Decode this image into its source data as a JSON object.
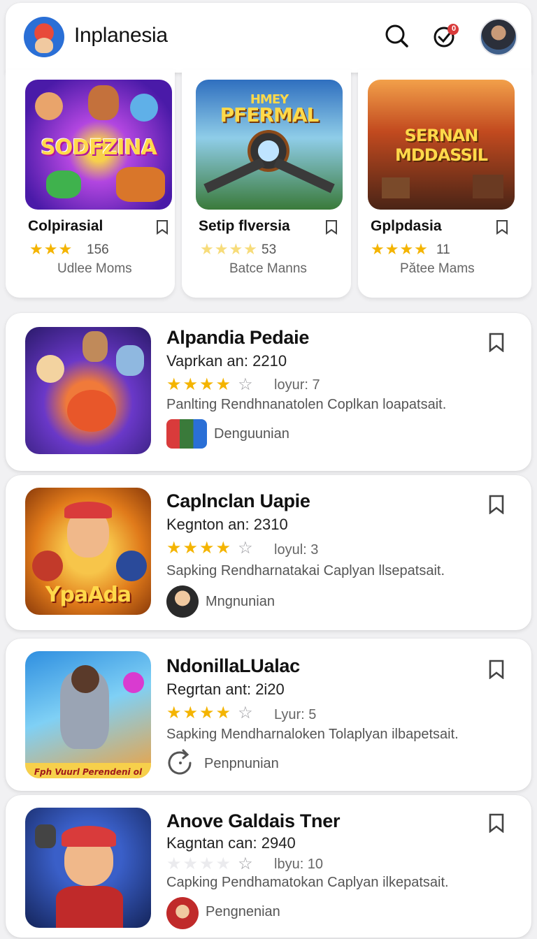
{
  "header": {
    "app_name": "Inplanesia",
    "notification_count": "0"
  },
  "top_cards": [
    {
      "art_text": "SODFZINA",
      "title": "Colpirasial",
      "stars": "★★★",
      "count": "156",
      "sub": "Udlee Moms",
      "colors": [
        "#6b2bd9",
        "#e0479e"
      ]
    },
    {
      "art_text_top": "HMEY",
      "art_text": "PFERMAL",
      "title": "Setip flversia",
      "stars": "★★★★",
      "count": "53",
      "sub": "Batce Manns",
      "colors": [
        "#1f6fb8",
        "#7fc9f0"
      ]
    },
    {
      "art_text": "SERNAN MDDASSIL",
      "title": "Gplpdasia",
      "stars": "★★★★",
      "count": "11",
      "sub": "Pătee Mams",
      "colors": [
        "#a33a1d",
        "#f08a2e"
      ]
    }
  ],
  "rows": [
    {
      "title": "Alpandia Pedaie",
      "meta": "Vaprkan an:  2210",
      "filled": "★★★★",
      "empty": "☆",
      "label": "loyur:  7",
      "desc": "Panlting Rendhnanatolen Coplkan loapatsait.",
      "dev": "Denguunian"
    },
    {
      "title": "Caplnclan Uapie",
      "meta": "Kegnton an:  2310",
      "filled": "★★★★",
      "empty": "☆",
      "label": "loyul:  3",
      "desc": "Sapking Rendharnatakai Caplyan llsepatsait.",
      "dev": "Mngnunian",
      "art_text": "YpaAda"
    },
    {
      "title": "NdonillaLUalac",
      "meta": "Regrtan ant:  2i20",
      "filled": "★★★★",
      "empty": "☆",
      "label": "Lyur:  5",
      "desc": "Sapking Mendharnaloken Tolaplyan ilbapetsait.",
      "dev": "Penpnunian",
      "art_text": "Fph Vuurl Perendeni ol"
    },
    {
      "title": "Anove Galdais Tner",
      "meta": "Kagntan can:  2940",
      "filled": "",
      "empty": "☆",
      "label": "lbyu:  10",
      "desc": "Capking Pendhamatokan Caplyan ilkepatsait.",
      "dev": "Pengnenian"
    }
  ],
  "colors": {
    "star": "#f4b400",
    "accent": "#d93b3b"
  }
}
